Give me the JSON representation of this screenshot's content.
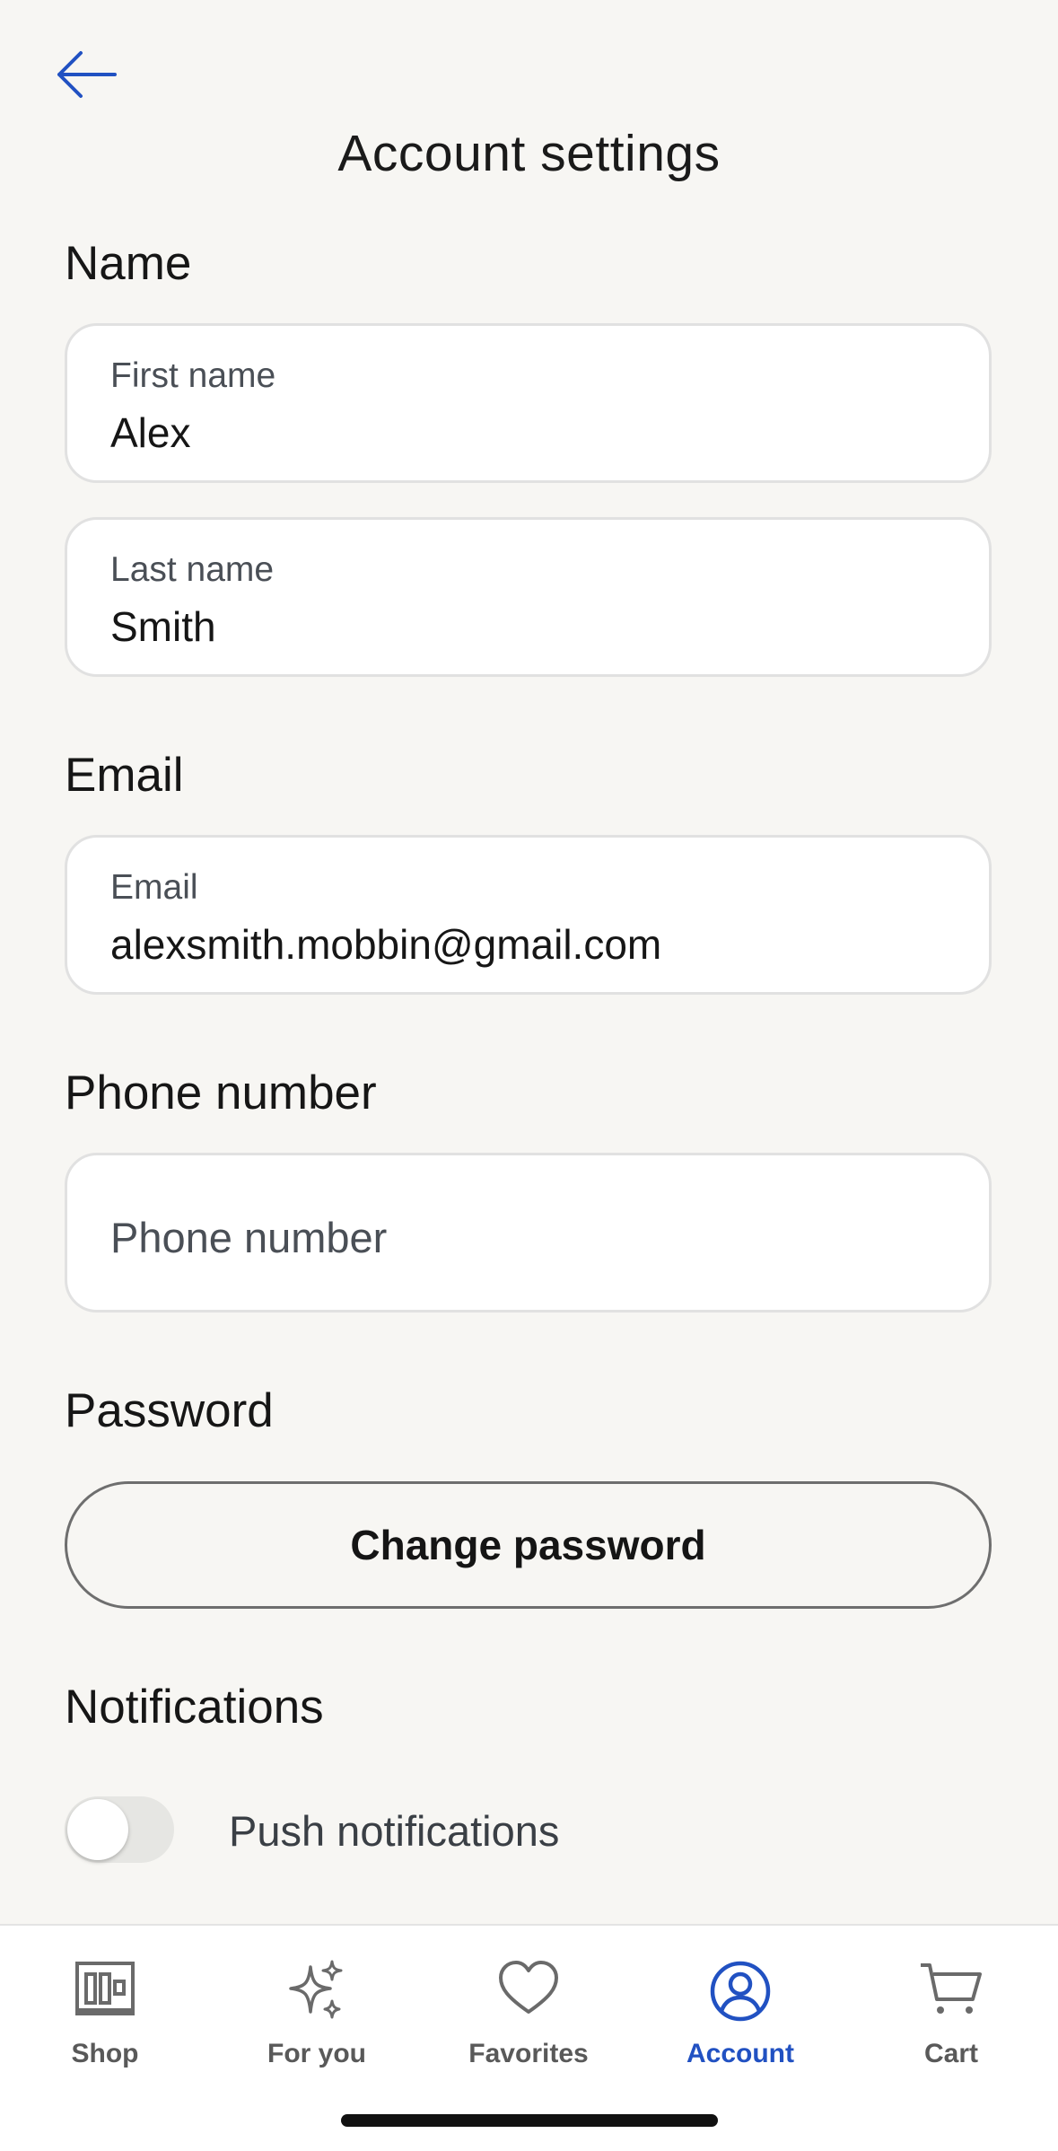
{
  "header": {
    "title": "Account settings",
    "back_icon": "arrow-left-icon"
  },
  "sections": {
    "name": {
      "title": "Name",
      "first_name": {
        "label": "First name",
        "value": "Alex"
      },
      "last_name": {
        "label": "Last name",
        "value": "Smith"
      }
    },
    "email": {
      "title": "Email",
      "field": {
        "label": "Email",
        "value": "alexsmith.mobbin@gmail.com"
      }
    },
    "phone": {
      "title": "Phone number",
      "field": {
        "placeholder": "Phone number",
        "value": ""
      }
    },
    "password": {
      "title": "Password",
      "button_label": "Change password"
    },
    "notifications": {
      "title": "Notifications",
      "push": {
        "label": "Push notifications",
        "enabled": false
      }
    }
  },
  "tabbar": {
    "active": "Account",
    "active_color": "#2151c2",
    "tabs": [
      {
        "label": "Shop",
        "icon": "shop-icon"
      },
      {
        "label": "For you",
        "icon": "sparkle-icon"
      },
      {
        "label": "Favorites",
        "icon": "heart-icon"
      },
      {
        "label": "Account",
        "icon": "account-icon"
      },
      {
        "label": "Cart",
        "icon": "cart-icon"
      }
    ]
  }
}
